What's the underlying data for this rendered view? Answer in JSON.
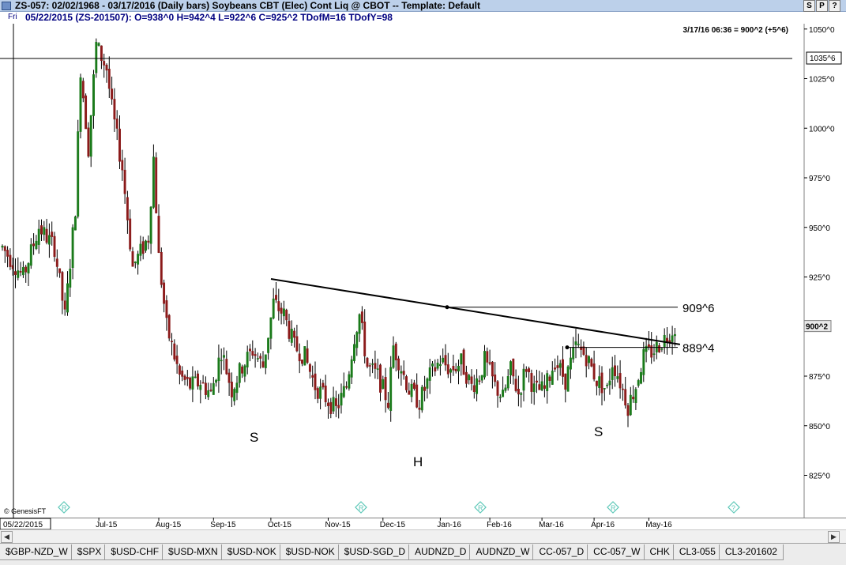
{
  "window": {
    "title": "ZS-057:  02/02/1968 - 03/17/2016  (Daily bars)   Soybeans CBT (Elec) Cont Liq @ CBOT  --  Template: Default",
    "buttons": [
      "S",
      "P",
      "?"
    ]
  },
  "infobar": {
    "day": "Fri",
    "text": "05/22/2015 (ZS-201507):  O=938^0  H=942^4  L=922^6  C=925^2  TDofM=16  TDofY=98"
  },
  "chart": {
    "last_update": "3/17/16 06:36 = 900^2 (+5^6)",
    "crosshair_price": "1035^6",
    "current_price": "900^2",
    "crosshair_date": "05/22/2015",
    "watermark": "© GenesisFT",
    "colors": {
      "up": "#1a7a1a",
      "down": "#8b1a1a",
      "line": "#000000",
      "grid": "#c0c0c0",
      "marker": "#5ec8b8"
    }
  },
  "chart_data": {
    "type": "candlestick",
    "title": "",
    "ylim": [
      812,
      1055
    ],
    "y_ticks": [
      "1050^0",
      "1025^0",
      "1000^0",
      "975^0",
      "950^0",
      "925^0",
      "900^0",
      "875^0",
      "850^0",
      "825^0"
    ],
    "y_tick_values": [
      1050,
      1025,
      1000,
      975,
      950,
      925,
      900,
      875,
      850,
      825
    ],
    "x_labels": [
      "Jul-15",
      "Aug-15",
      "Sep-15",
      "Oct-15",
      "Nov-15",
      "Dec-15",
      "Jan-16",
      "Feb-16",
      "Mar-16",
      "Apr-16",
      "May-16"
    ],
    "x_label_positions": [
      77,
      100,
      121,
      143,
      165,
      186,
      208,
      227,
      247,
      267,
      288
    ],
    "label_index_scale": [
      0,
      1,
      2,
      3,
      4,
      5,
      6,
      7,
      8,
      9,
      10
    ],
    "annotations": [
      {
        "text": "909^6",
        "value": 909.75,
        "kind": "resistance"
      },
      {
        "text": "889^4",
        "value": 889.5,
        "kind": "support"
      },
      {
        "text": "S",
        "value": 847,
        "index": 76,
        "kind": "shoulder"
      },
      {
        "text": "H",
        "value": 832,
        "index": 129,
        "kind": "head"
      },
      {
        "text": "S",
        "value": 848,
        "index": 232,
        "kind": "shoulder"
      }
    ],
    "neckline": {
      "start_index": 80,
      "start_value": 924,
      "end_index": 263,
      "end_value": 891
    },
    "resistance_line": {
      "start_index": 137,
      "end_index": 258,
      "value": 909.75
    },
    "support_line": {
      "start_index": 221,
      "end_index": 258,
      "value": 889.5
    },
    "key_points": [
      [
        0,
        940
      ],
      [
        8,
        925
      ],
      [
        14,
        950
      ],
      [
        20,
        940
      ],
      [
        24,
        905
      ],
      [
        28,
        960
      ],
      [
        30,
        1030
      ],
      [
        33,
        990
      ],
      [
        36,
        1042
      ],
      [
        40,
        1030
      ],
      [
        42,
        1010
      ],
      [
        46,
        980
      ],
      [
        50,
        930
      ],
      [
        56,
        945
      ],
      [
        58,
        985
      ],
      [
        60,
        935
      ],
      [
        63,
        900
      ],
      [
        68,
        875
      ],
      [
        72,
        870
      ],
      [
        76,
        872
      ],
      [
        80,
        866
      ],
      [
        84,
        888
      ],
      [
        88,
        868
      ],
      [
        92,
        880
      ],
      [
        96,
        888
      ],
      [
        100,
        880
      ],
      [
        104,
        912
      ],
      [
        108,
        906
      ],
      [
        112,
        890
      ],
      [
        116,
        885
      ],
      [
        120,
        870
      ],
      [
        124,
        864
      ],
      [
        128,
        858
      ],
      [
        132,
        870
      ],
      [
        135,
        895
      ],
      [
        137,
        906
      ],
      [
        140,
        880
      ],
      [
        144,
        875
      ],
      [
        148,
        862
      ],
      [
        150,
        890
      ],
      [
        152,
        883
      ],
      [
        156,
        868
      ],
      [
        160,
        862
      ],
      [
        164,
        875
      ],
      [
        168,
        883
      ],
      [
        172,
        878
      ],
      [
        176,
        882
      ],
      [
        180,
        870
      ],
      [
        183,
        875
      ],
      [
        185,
        883
      ],
      [
        189,
        870
      ],
      [
        192,
        864
      ],
      [
        195,
        878
      ],
      [
        198,
        866
      ],
      [
        201,
        880
      ],
      [
        204,
        868
      ],
      [
        208,
        868
      ],
      [
        212,
        883
      ],
      [
        216,
        873
      ],
      [
        220,
        890
      ],
      [
        224,
        885
      ],
      [
        228,
        873
      ],
      [
        232,
        868
      ],
      [
        234,
        882
      ],
      [
        236,
        876
      ],
      [
        240,
        860
      ],
      [
        243,
        870
      ],
      [
        246,
        885
      ],
      [
        250,
        888
      ],
      [
        254,
        894
      ],
      [
        258,
        900
      ]
    ]
  },
  "tabs": [
    "$GBP-NZD_W",
    "$SPX",
    "$USD-CHF",
    "$USD-MXN",
    "$USD-NOK",
    "$USD-NOK",
    "$USD-SGD_D",
    "AUDNZD_D",
    "AUDNZD_W",
    "CC-057_D",
    "CC-057_W",
    "CHK",
    "CL3-055",
    "CL3-201602"
  ]
}
